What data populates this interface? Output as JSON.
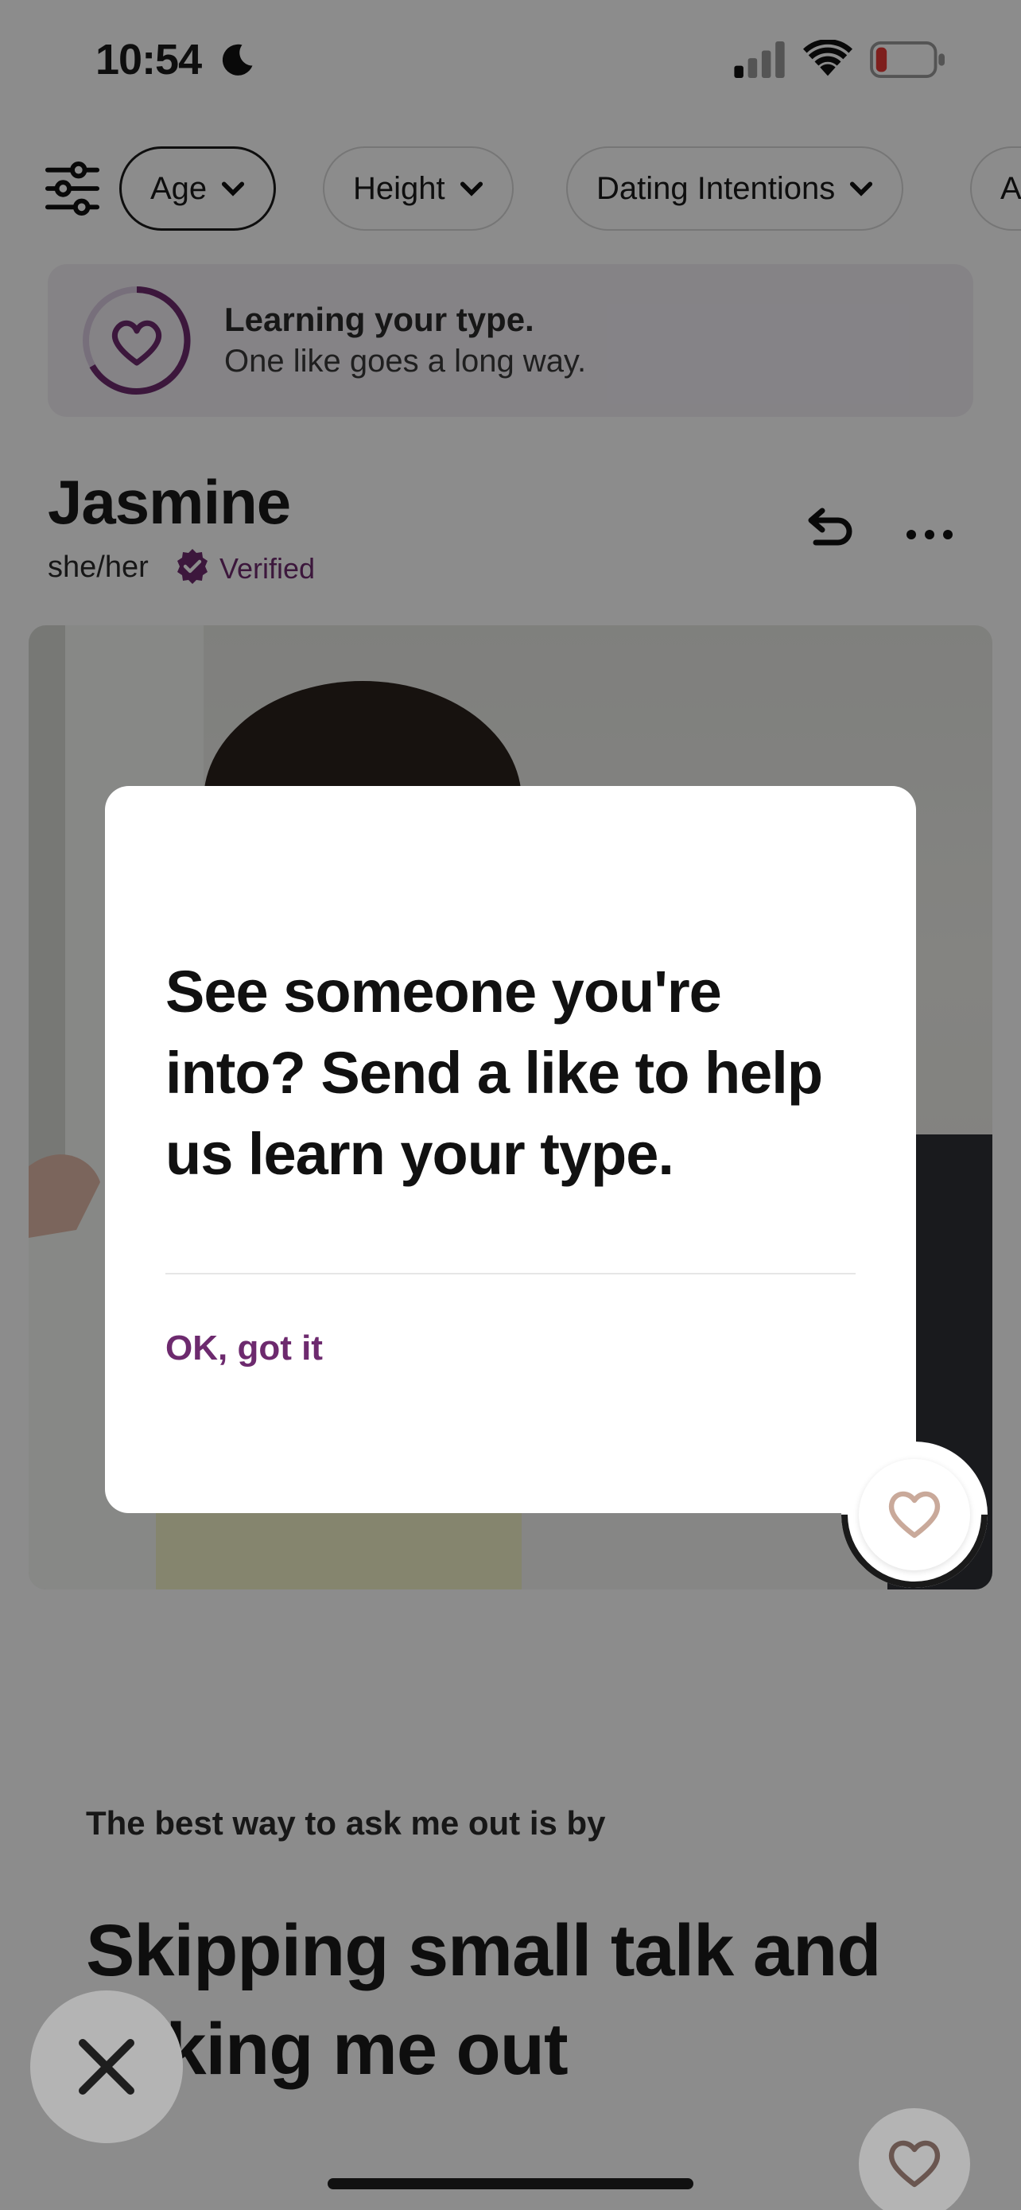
{
  "status_bar": {
    "time": "10:54"
  },
  "filters": {
    "chips": [
      {
        "label": "Age"
      },
      {
        "label": "Height"
      },
      {
        "label": "Dating Intentions"
      },
      {
        "label": "A"
      }
    ]
  },
  "banner": {
    "title": "Learning your type.",
    "subtitle": "One like goes a long way."
  },
  "profile": {
    "name": "Jasmine",
    "pronouns": "she/her",
    "verified_label": "Verified"
  },
  "prompt": {
    "question": "The best way to ask me out is by",
    "answer": "Skipping small talk and asking me out"
  },
  "dialog": {
    "message": "See someone you're into? Send a like to help us learn your type.",
    "ok_label": "OK, got it"
  },
  "colors": {
    "accent": "#6d2a6e",
    "like_heart": "#c9a99a",
    "battery_low": "#e53935"
  },
  "icons": [
    "moon-icon",
    "signal-icon",
    "wifi-icon",
    "battery-icon",
    "filter-icon",
    "chevron-down-icon",
    "heart-icon",
    "verified-icon",
    "undo-icon",
    "more-icon",
    "close-icon"
  ]
}
